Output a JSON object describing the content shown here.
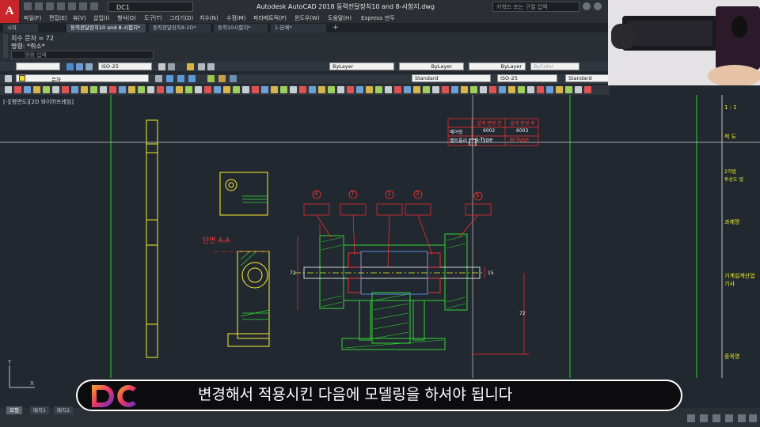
{
  "app": {
    "logo_letter": "A",
    "workspace": "DC1",
    "title": "Autodesk AutoCAD 2018    동력전달장치10 and 8-시험지.dwg",
    "search_placeholder": "키워드 또는 구절 입력"
  },
  "menu": [
    "파일(F)",
    "편집(E)",
    "뷰(V)",
    "삽입(I)",
    "형식(O)",
    "도구(T)",
    "그리기(D)",
    "치수(N)",
    "수정(M)",
    "파라메트릭(P)",
    "윈도우(W)",
    "도움말(H)",
    "Express",
    "만두"
  ],
  "tabs": [
    {
      "label": "시작",
      "active": false
    },
    {
      "label": "동력전달장치10 and 8-시험지*",
      "active": true
    },
    {
      "label": "동력전달장치8-2D*",
      "active": false
    },
    {
      "label": "동력10시험지*",
      "active": false
    },
    {
      "label": "1-본체*",
      "active": false
    }
  ],
  "command": {
    "line1": "치수 문자 = 72",
    "line2": "명령: *취소*",
    "placeholder": "명령 입력"
  },
  "toolbars": {
    "dimstyle1": "ISO-25",
    "layer_name": "문자",
    "bylayer_color": "ByLayer",
    "bylayer_linetype": "ByLayer",
    "bylayer_lineweight": "ByLayer",
    "bycolor": "ByColor",
    "textstyle": "Standard",
    "dimstyle2": "ISO-25",
    "tablestyle": "Standard"
  },
  "viewport_label": "[-][평면도][2D 와이어프레임]",
  "drawing": {
    "section_label": "단면 A-A",
    "table_header": [
      "설계 변경 전",
      "설계 변경 후"
    ],
    "table_row1": [
      "베어링",
      "6002",
      "6003"
    ],
    "table_row2": [
      "벨트풀리",
      "A-Type",
      "M-Type"
    ],
    "balloons": [
      "4",
      "7",
      "1",
      "3",
      "5"
    ],
    "dim_72_a": "72",
    "dim_72_b": "72",
    "dim_15": "15",
    "title_block_right": [
      "1 : 1",
      "척 도",
      "2각법",
      "투상도 법",
      "과제명",
      "기계설계산업기사",
      "종목명"
    ]
  },
  "layout_tabs": [
    {
      "label": "모형",
      "active": true
    },
    {
      "label": "배치1",
      "active": false
    },
    {
      "label": "배치2",
      "active": false
    }
  ],
  "subtitle": "변경해서 적용시킨 다음에 모델링을 하셔야 됩니다",
  "colors": {
    "cad_bg": "#212830",
    "green": "#34d434",
    "red": "#ff3030",
    "yellow": "#f2f22c"
  }
}
